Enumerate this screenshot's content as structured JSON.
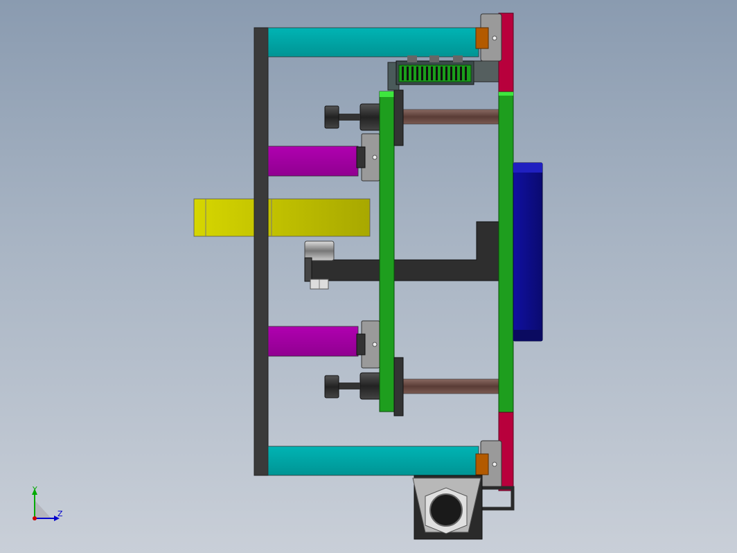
{
  "triad": {
    "y_label": "Y",
    "z_label": "Z"
  },
  "colors": {
    "background_top": "#8a9bb0",
    "background_bottom": "#c9cfd8",
    "frame_plate": "#3a3a3a",
    "cyan_rail": "#00a6a6",
    "magenta_rail": "#a800a8",
    "yellow_shaft": "#c8c800",
    "green_plate": "#1e9e1e",
    "crimson_plate": "#b8003c",
    "motor_blue": "#1a1aa0",
    "bolt_rod": "#6b4a44",
    "bearing_brown": "#b35a00",
    "block_gray": "#8c8c8c",
    "axis_x": "#cc0000",
    "axis_y": "#00aa00",
    "axis_z": "#0000cc"
  }
}
